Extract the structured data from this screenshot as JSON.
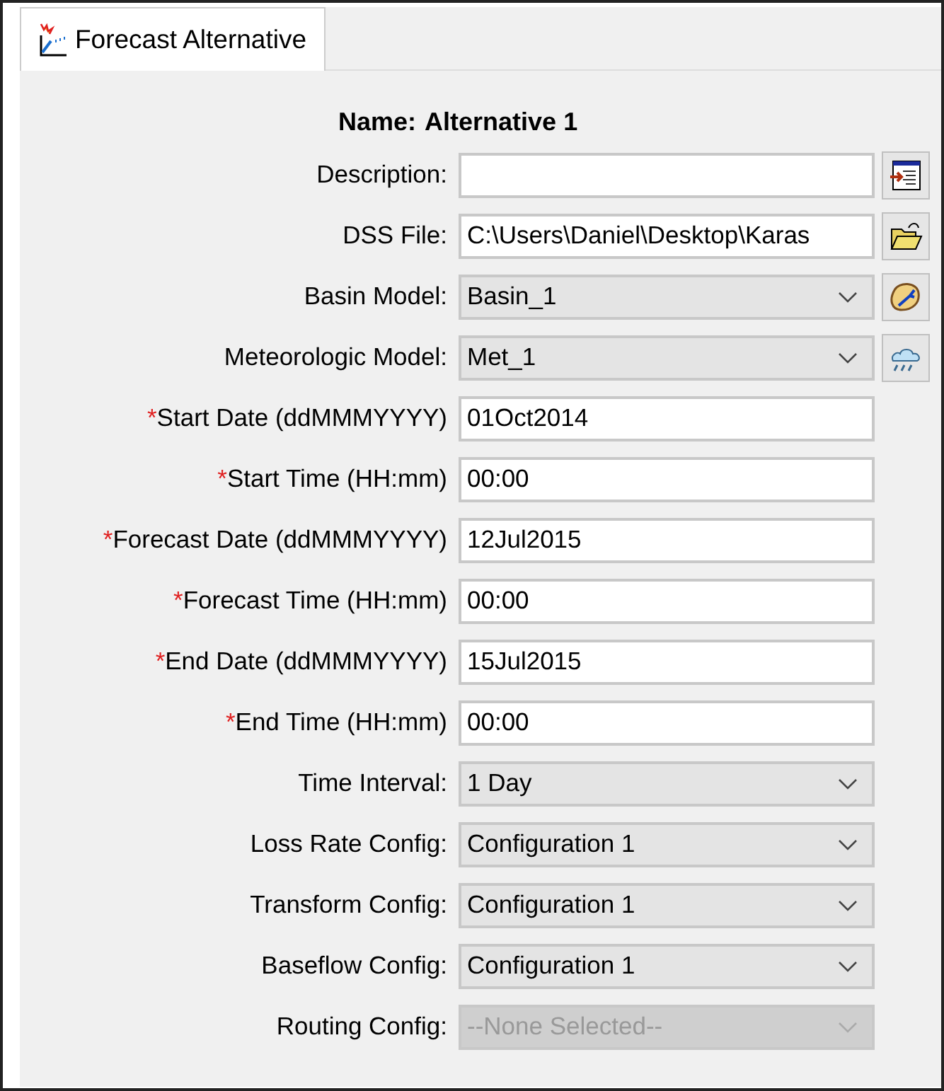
{
  "tab": {
    "label": "Forecast Alternative",
    "selected": true
  },
  "name": {
    "label": "Name:",
    "value": "Alternative 1"
  },
  "fields": [
    {
      "label": "Description:",
      "kind": "text",
      "disabled": false
    },
    {
      "label": "DSS File:",
      "kind": "text",
      "value": "C:\\Users\\Daniel\\Desktop\\Karas",
      "disabled": false
    },
    {
      "label": "Basin Model:",
      "kind": "combo",
      "value": "Basin_1",
      "disabled": false
    },
    {
      "label": "Meteorologic Model:",
      "kind": "combo",
      "value": "Met_1",
      "disabled": false
    },
    {
      "required_mark": "*",
      "label": "Start Date (ddMMMYYYY)",
      "kind": "text",
      "value": "01Oct2014",
      "disabled": false
    },
    {
      "required_mark": "*",
      "label": "Start Time (HH:mm)",
      "kind": "text",
      "value": "00:00",
      "disabled": false
    },
    {
      "required_mark": "*",
      "label": "Forecast Date (ddMMMYYYY)",
      "kind": "text",
      "value": "12Jul2015",
      "disabled": false
    },
    {
      "required_mark": "*",
      "label": "Forecast Time (HH:mm)",
      "kind": "text",
      "value": "00:00",
      "disabled": false
    },
    {
      "required_mark": "*",
      "label": "End Date (ddMMMYYYY)",
      "kind": "text",
      "value": "15Jul2015",
      "disabled": false
    },
    {
      "required_mark": "*",
      "label": "End Time (HH:mm)",
      "kind": "text",
      "value": "00:00",
      "disabled": false
    },
    {
      "label": "Time Interval:",
      "kind": "combo",
      "value": "1 Day",
      "disabled": false
    },
    {
      "label": "Loss Rate Config:",
      "kind": "combo",
      "value": "Configuration 1",
      "disabled": false
    },
    {
      "label": "Transform Config:",
      "kind": "combo",
      "value": "Configuration 1",
      "disabled": false
    },
    {
      "label": "Baseflow Config:",
      "kind": "combo",
      "value": "Configuration 1",
      "disabled": false
    },
    {
      "label": "Routing Config:",
      "kind": "combo",
      "value": "--None Selected--",
      "disabled": true
    }
  ]
}
